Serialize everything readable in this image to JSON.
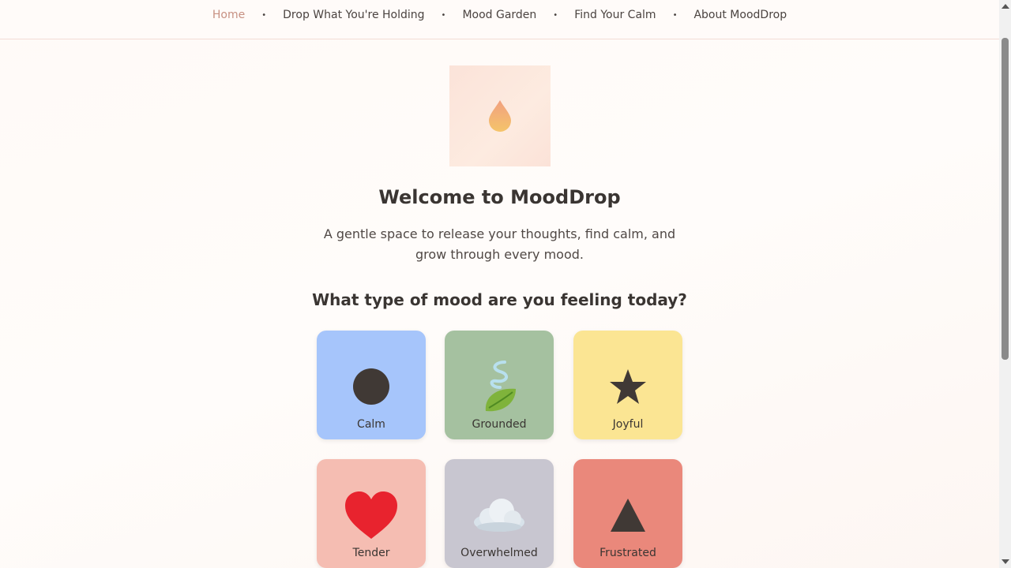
{
  "nav": {
    "items": [
      {
        "label": "Home",
        "active": true
      },
      {
        "label": "Drop What You're Holding"
      },
      {
        "label": "Mood Garden"
      },
      {
        "label": "Find Your Calm"
      },
      {
        "label": "About MoodDrop"
      }
    ],
    "separator": "•"
  },
  "hero": {
    "icon": "droplet-icon"
  },
  "welcome": {
    "title": "Welcome to MoodDrop",
    "subtitle": "A gentle space to release your thoughts, find calm, and grow through every mood."
  },
  "mood_question": "What type of mood are you feeling today?",
  "moods": [
    {
      "label": "Calm",
      "icon": "circle-icon",
      "color": "#a6c5fb"
    },
    {
      "label": "Grounded",
      "icon": "leaf-icon",
      "color": "#a5c1a0"
    },
    {
      "label": "Joyful",
      "icon": "star-icon",
      "color": "#fbe593"
    },
    {
      "label": "Tender",
      "icon": "heart-icon",
      "color": "#f5bdb2"
    },
    {
      "label": "Overwhelmed",
      "icon": "cloud-icon",
      "color": "#c8c6d0"
    },
    {
      "label": "Frustrated",
      "icon": "triangle-icon",
      "color": "#ea887b"
    }
  ]
}
